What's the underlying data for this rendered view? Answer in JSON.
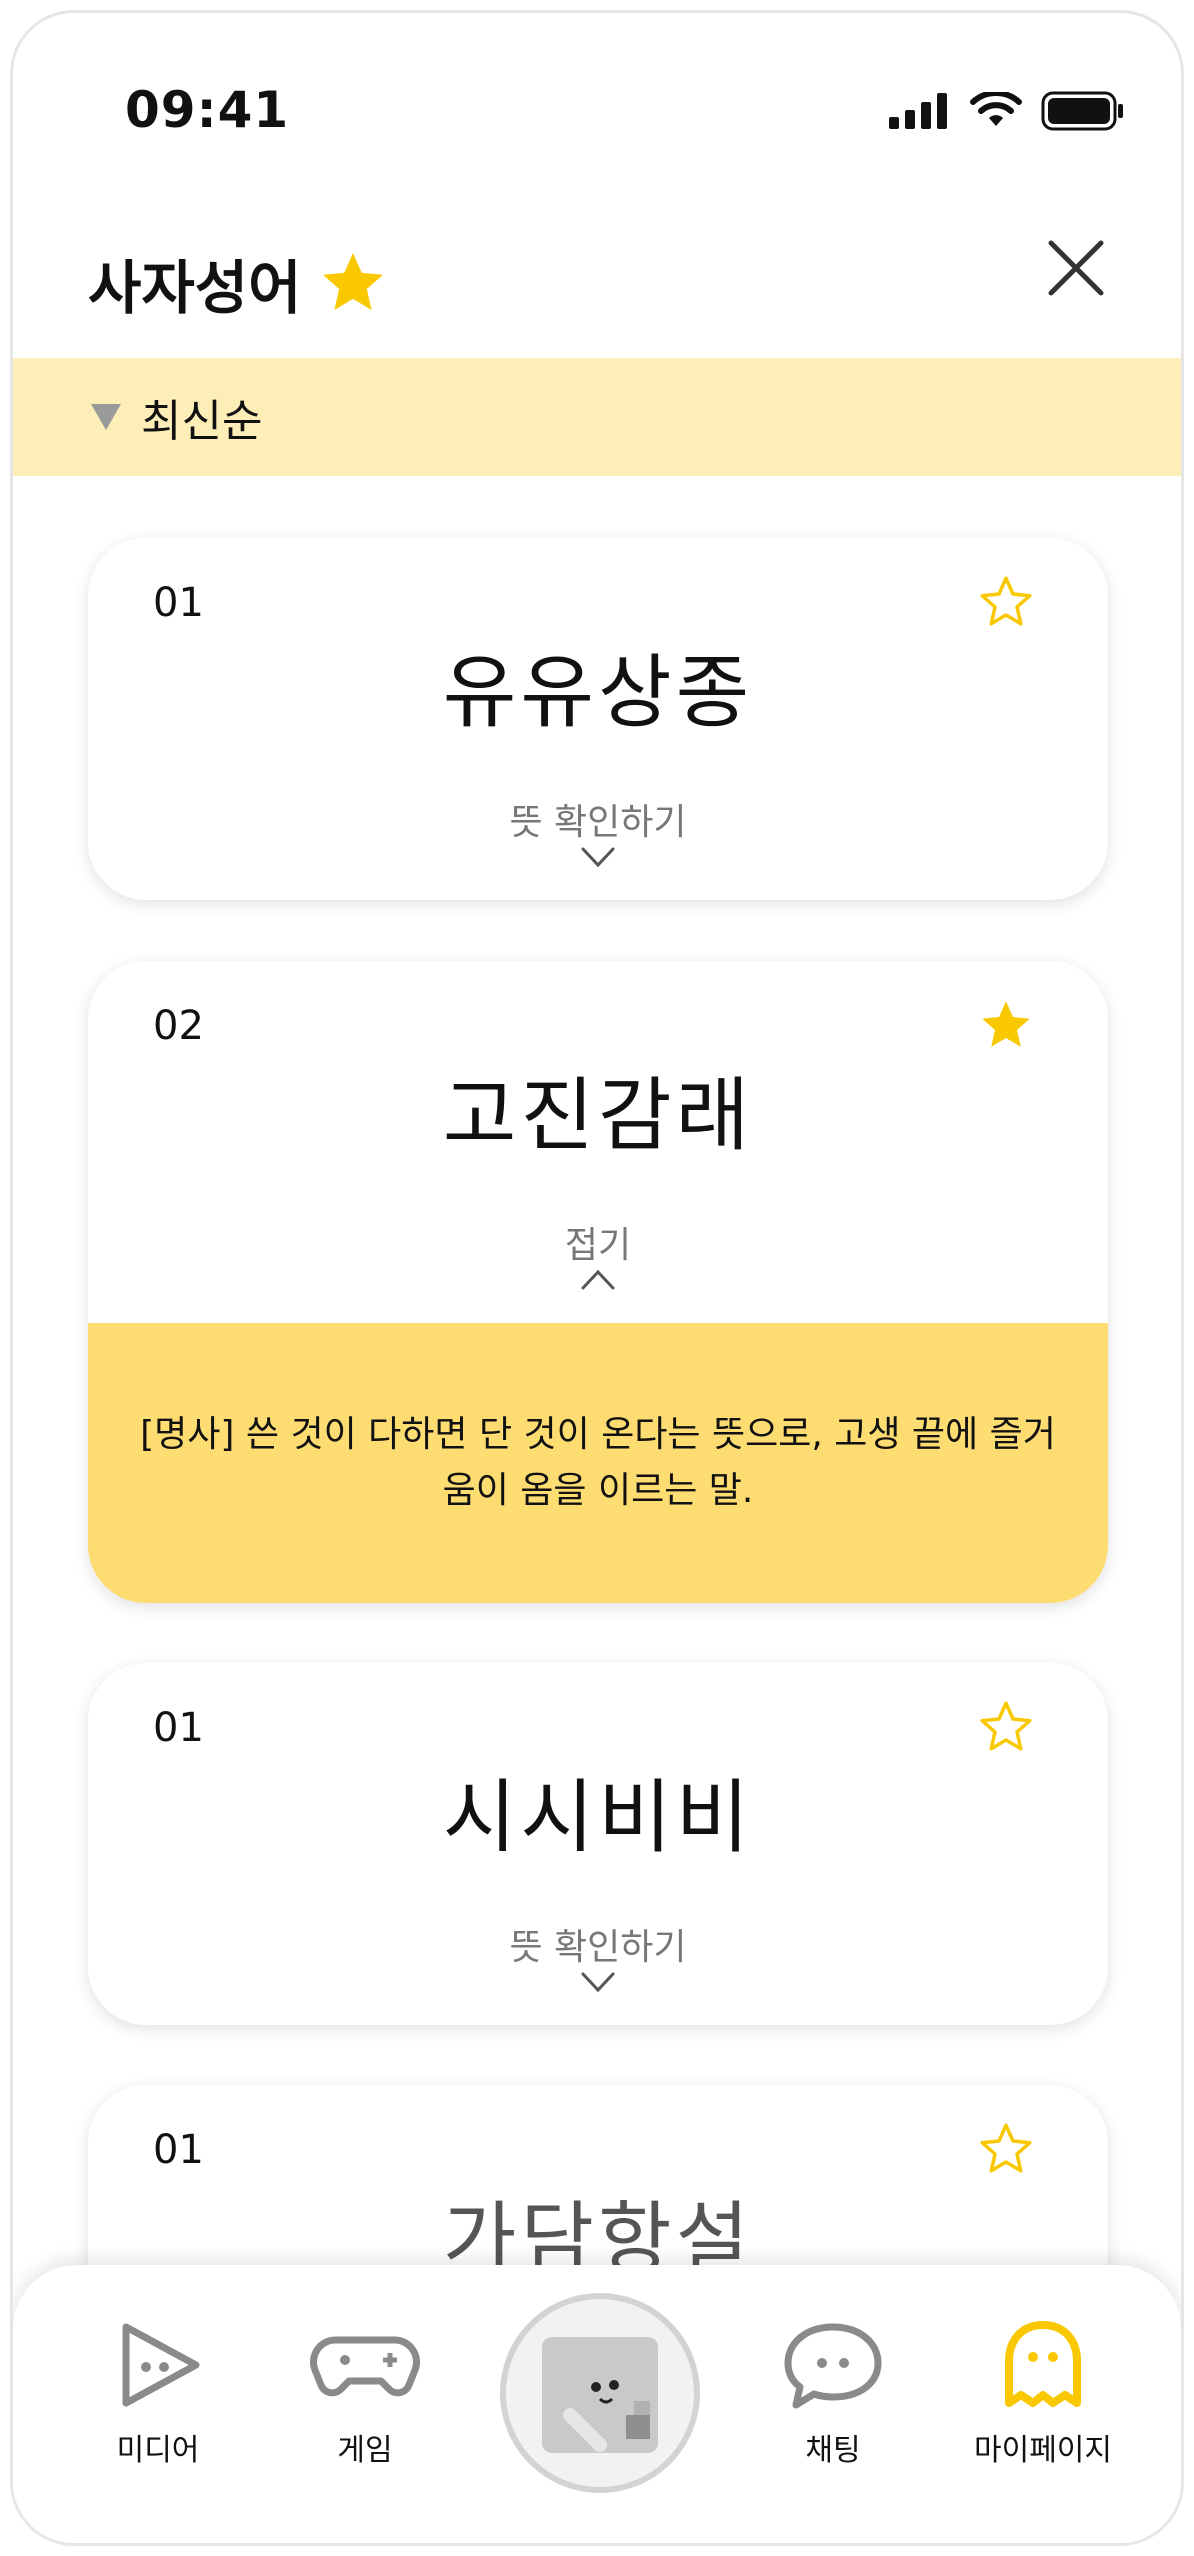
{
  "status_bar": {
    "time": "09:41"
  },
  "header": {
    "title": "사자성어"
  },
  "sort": {
    "label": "최신순"
  },
  "cards": [
    {
      "num": "01",
      "word": "유유상종",
      "toggle": "뜻 확인하기",
      "favorite": false
    },
    {
      "num": "02",
      "word": "고진감래",
      "toggle": "접기",
      "favorite": true,
      "meaning": "[명사] 쓴 것이 다하면 단 것이 온다는 뜻으로, 고생 끝에 즐거움이 옴을 이르는 말."
    },
    {
      "num": "01",
      "word": "시시비비",
      "toggle": "뜻 확인하기",
      "favorite": false
    },
    {
      "num": "01",
      "word": "가담항설",
      "favorite": false
    }
  ],
  "nav": {
    "media": "미디어",
    "game": "게임",
    "chat": "채팅",
    "mypage": "마이페이지"
  },
  "colors": {
    "accent": "#f9c800",
    "highlight": "#fddc72",
    "sortbar": "#fdedb7"
  }
}
